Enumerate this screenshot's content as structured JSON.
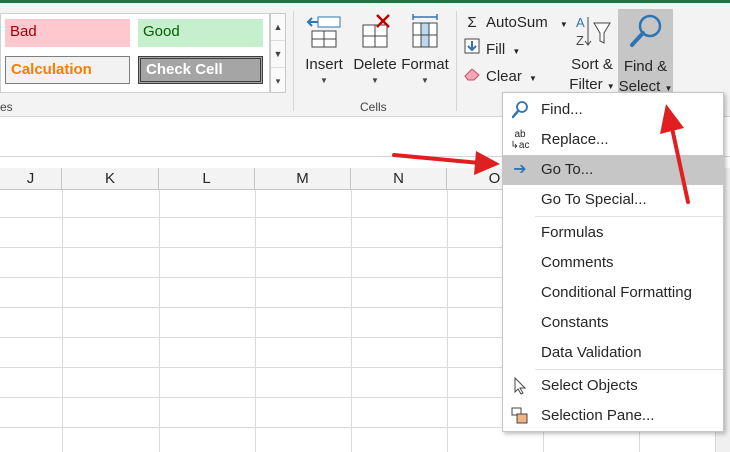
{
  "ribbon": {
    "styles": {
      "bad": "Bad",
      "good": "Good",
      "calculation": "Calculation",
      "check_cell": "Check Cell",
      "group_label_partial": "es"
    },
    "cells_group": {
      "insert": "Insert",
      "delete": "Delete",
      "format": "Format",
      "group_label": "Cells"
    },
    "editing_group": {
      "autosum": "AutoSum",
      "fill": "Fill",
      "clear": "Clear",
      "sort_filter_line1": "Sort &",
      "sort_filter_line2": "Filter",
      "find_select_line1": "Find &",
      "find_select_line2": "Select"
    }
  },
  "columns": [
    "J",
    "K",
    "L",
    "M",
    "N",
    "O"
  ],
  "menu": {
    "items": [
      {
        "label": "Find...",
        "icon": "search-icon"
      },
      {
        "label": "Replace...",
        "icon": "replace-icon"
      },
      {
        "label": "Go To...",
        "icon": "arrow-right-icon"
      },
      {
        "label": "Go To Special...",
        "icon": ""
      },
      {
        "label": "Formulas",
        "icon": ""
      },
      {
        "label": "Comments",
        "icon": ""
      },
      {
        "label": "Conditional Formatting",
        "icon": ""
      },
      {
        "label": "Constants",
        "icon": ""
      },
      {
        "label": "Data Validation",
        "icon": ""
      },
      {
        "label": "Select Objects",
        "icon": "pointer-icon"
      },
      {
        "label": "Selection Pane...",
        "icon": "selection-pane-icon"
      }
    ],
    "highlighted_index": 2
  },
  "colors": {
    "accent": "#217346",
    "annotation_arrow": "#e02020"
  }
}
